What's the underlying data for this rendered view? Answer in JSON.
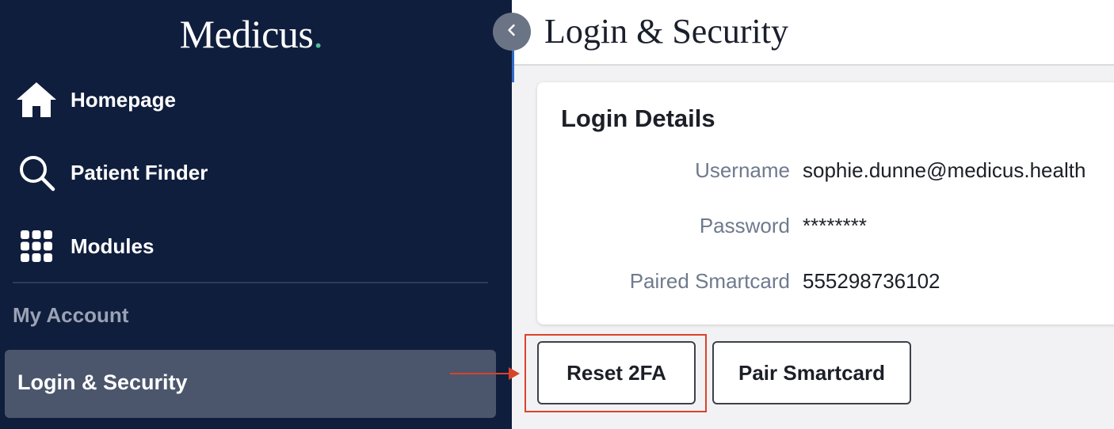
{
  "brand": {
    "name": "Medicus",
    "dot": "."
  },
  "sidebar": {
    "items": [
      {
        "label": "Homepage",
        "icon": "home-icon"
      },
      {
        "label": "Patient Finder",
        "icon": "search-icon"
      },
      {
        "label": "Modules",
        "icon": "grid-icon"
      }
    ],
    "section_label": "My Account",
    "active_item": {
      "label": "Login & Security"
    }
  },
  "header": {
    "title": "Login & Security"
  },
  "card": {
    "title": "Login Details",
    "rows": [
      {
        "label": "Username",
        "value": "sophie.dunne@medicus.health"
      },
      {
        "label": "Password",
        "value": "********"
      },
      {
        "label": "Paired Smartcard",
        "value": "555298736102"
      }
    ]
  },
  "actions": {
    "reset_2fa": "Reset 2FA",
    "pair_smartcard": "Pair Smartcard"
  },
  "colors": {
    "sidebar_bg": "#101e3d",
    "active_bg": "#4b566c",
    "brand_dot": "#4fc09a",
    "annotation": "#d9432a"
  }
}
